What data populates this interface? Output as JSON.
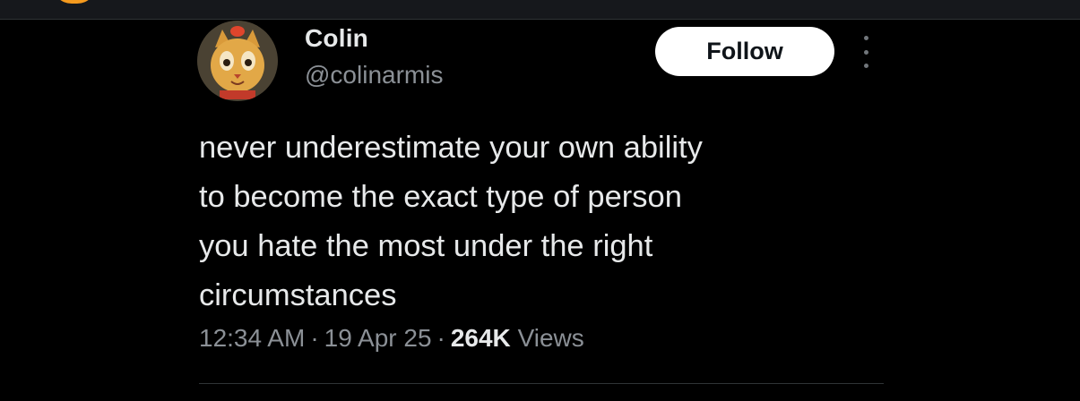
{
  "tweet": {
    "author_name": "Colin",
    "author_handle": "@colinarmis",
    "follow_label": "Follow",
    "text": "never underestimate your own ability\nto become the exact type of person\nyou hate the most under the right\ncircumstances",
    "time": "12:34 AM",
    "date": "19 Apr 25",
    "separator": "·",
    "views_count": "264K",
    "views_label": "Views"
  },
  "icons": {
    "more": "more-vertical-icon",
    "avatar": "avatar-image"
  },
  "colors": {
    "background": "#000000",
    "text_primary": "#e7e9ea",
    "text_secondary": "#8b9096",
    "follow_button_bg": "#ffffff",
    "follow_button_text": "#0f1419",
    "topbar_accent": "#f59a1e"
  }
}
